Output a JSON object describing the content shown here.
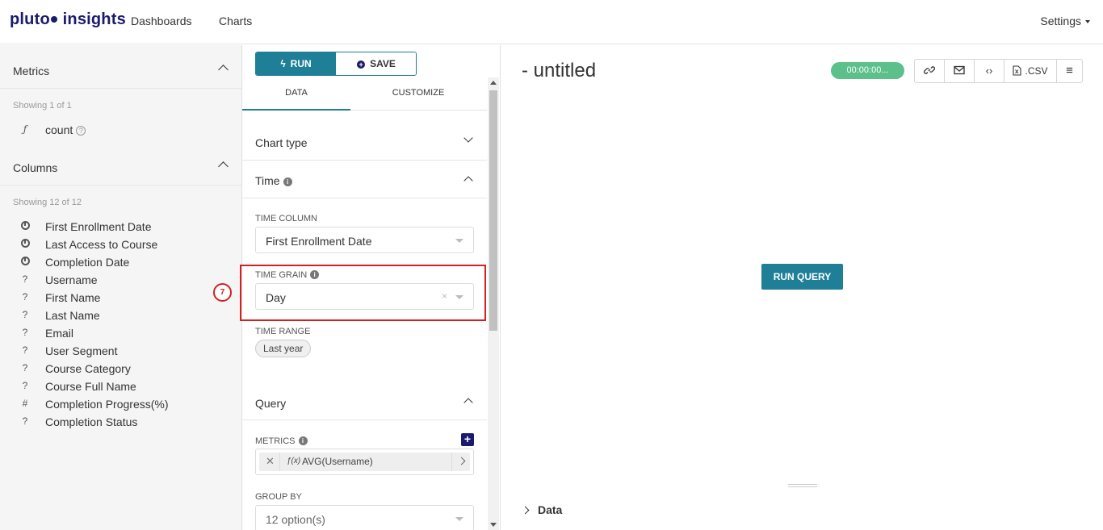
{
  "nav": {
    "logo_part1": "pluto",
    "logo_part2": "insights",
    "links": [
      "Dashboards",
      "Charts"
    ],
    "settings": "Settings"
  },
  "left": {
    "metrics_title": "Metrics",
    "metrics_showing": "Showing 1 of 1",
    "metrics": [
      {
        "icon": "function-icon",
        "label": "count"
      }
    ],
    "columns_title": "Columns",
    "columns_showing": "Showing 12 of 12",
    "columns": [
      {
        "icon": "clock-icon",
        "label": "First Enrollment Date"
      },
      {
        "icon": "clock-icon",
        "label": "Last Access to Course"
      },
      {
        "icon": "clock-icon",
        "label": "Completion Date"
      },
      {
        "icon": "string-icon",
        "label": "Username"
      },
      {
        "icon": "string-icon",
        "label": "First Name"
      },
      {
        "icon": "string-icon",
        "label": "Last Name"
      },
      {
        "icon": "string-icon",
        "label": "Email"
      },
      {
        "icon": "string-icon",
        "label": "User Segment"
      },
      {
        "icon": "string-icon",
        "label": "Course Category"
      },
      {
        "icon": "string-icon",
        "label": "Course Full Name"
      },
      {
        "icon": "numeric-icon",
        "label": "Completion Progress(%)"
      },
      {
        "icon": "string-icon",
        "label": "Completion Status"
      }
    ],
    "step_marker": "7"
  },
  "middle": {
    "run_label": "RUN",
    "save_label": "SAVE",
    "tabs": [
      "DATA",
      "CUSTOMIZE"
    ],
    "chart_type_title": "Chart type",
    "time_title": "Time",
    "time_column_label": "TIME COLUMN",
    "time_column_value": "First Enrollment Date",
    "time_grain_label": "TIME GRAIN",
    "time_grain_value": "Day",
    "time_range_label": "TIME RANGE",
    "time_range_value": "Last year",
    "query_title": "Query",
    "metrics_label": "METRICS",
    "metric_value": "AVG(Username)",
    "metric_fx": "ƒ(x)",
    "group_by_label": "GROUP BY",
    "group_by_value": "12 option(s)"
  },
  "right": {
    "chart_title": "- untitled",
    "timer": "00:00:00...",
    "csv_label": ".CSV",
    "run_query": "RUN QUERY",
    "data_section": "Data"
  },
  "colors": {
    "brand": "#1a1a6e",
    "primary": "#1e7f96",
    "timer": "#5cc08a",
    "highlight": "#d32020"
  }
}
